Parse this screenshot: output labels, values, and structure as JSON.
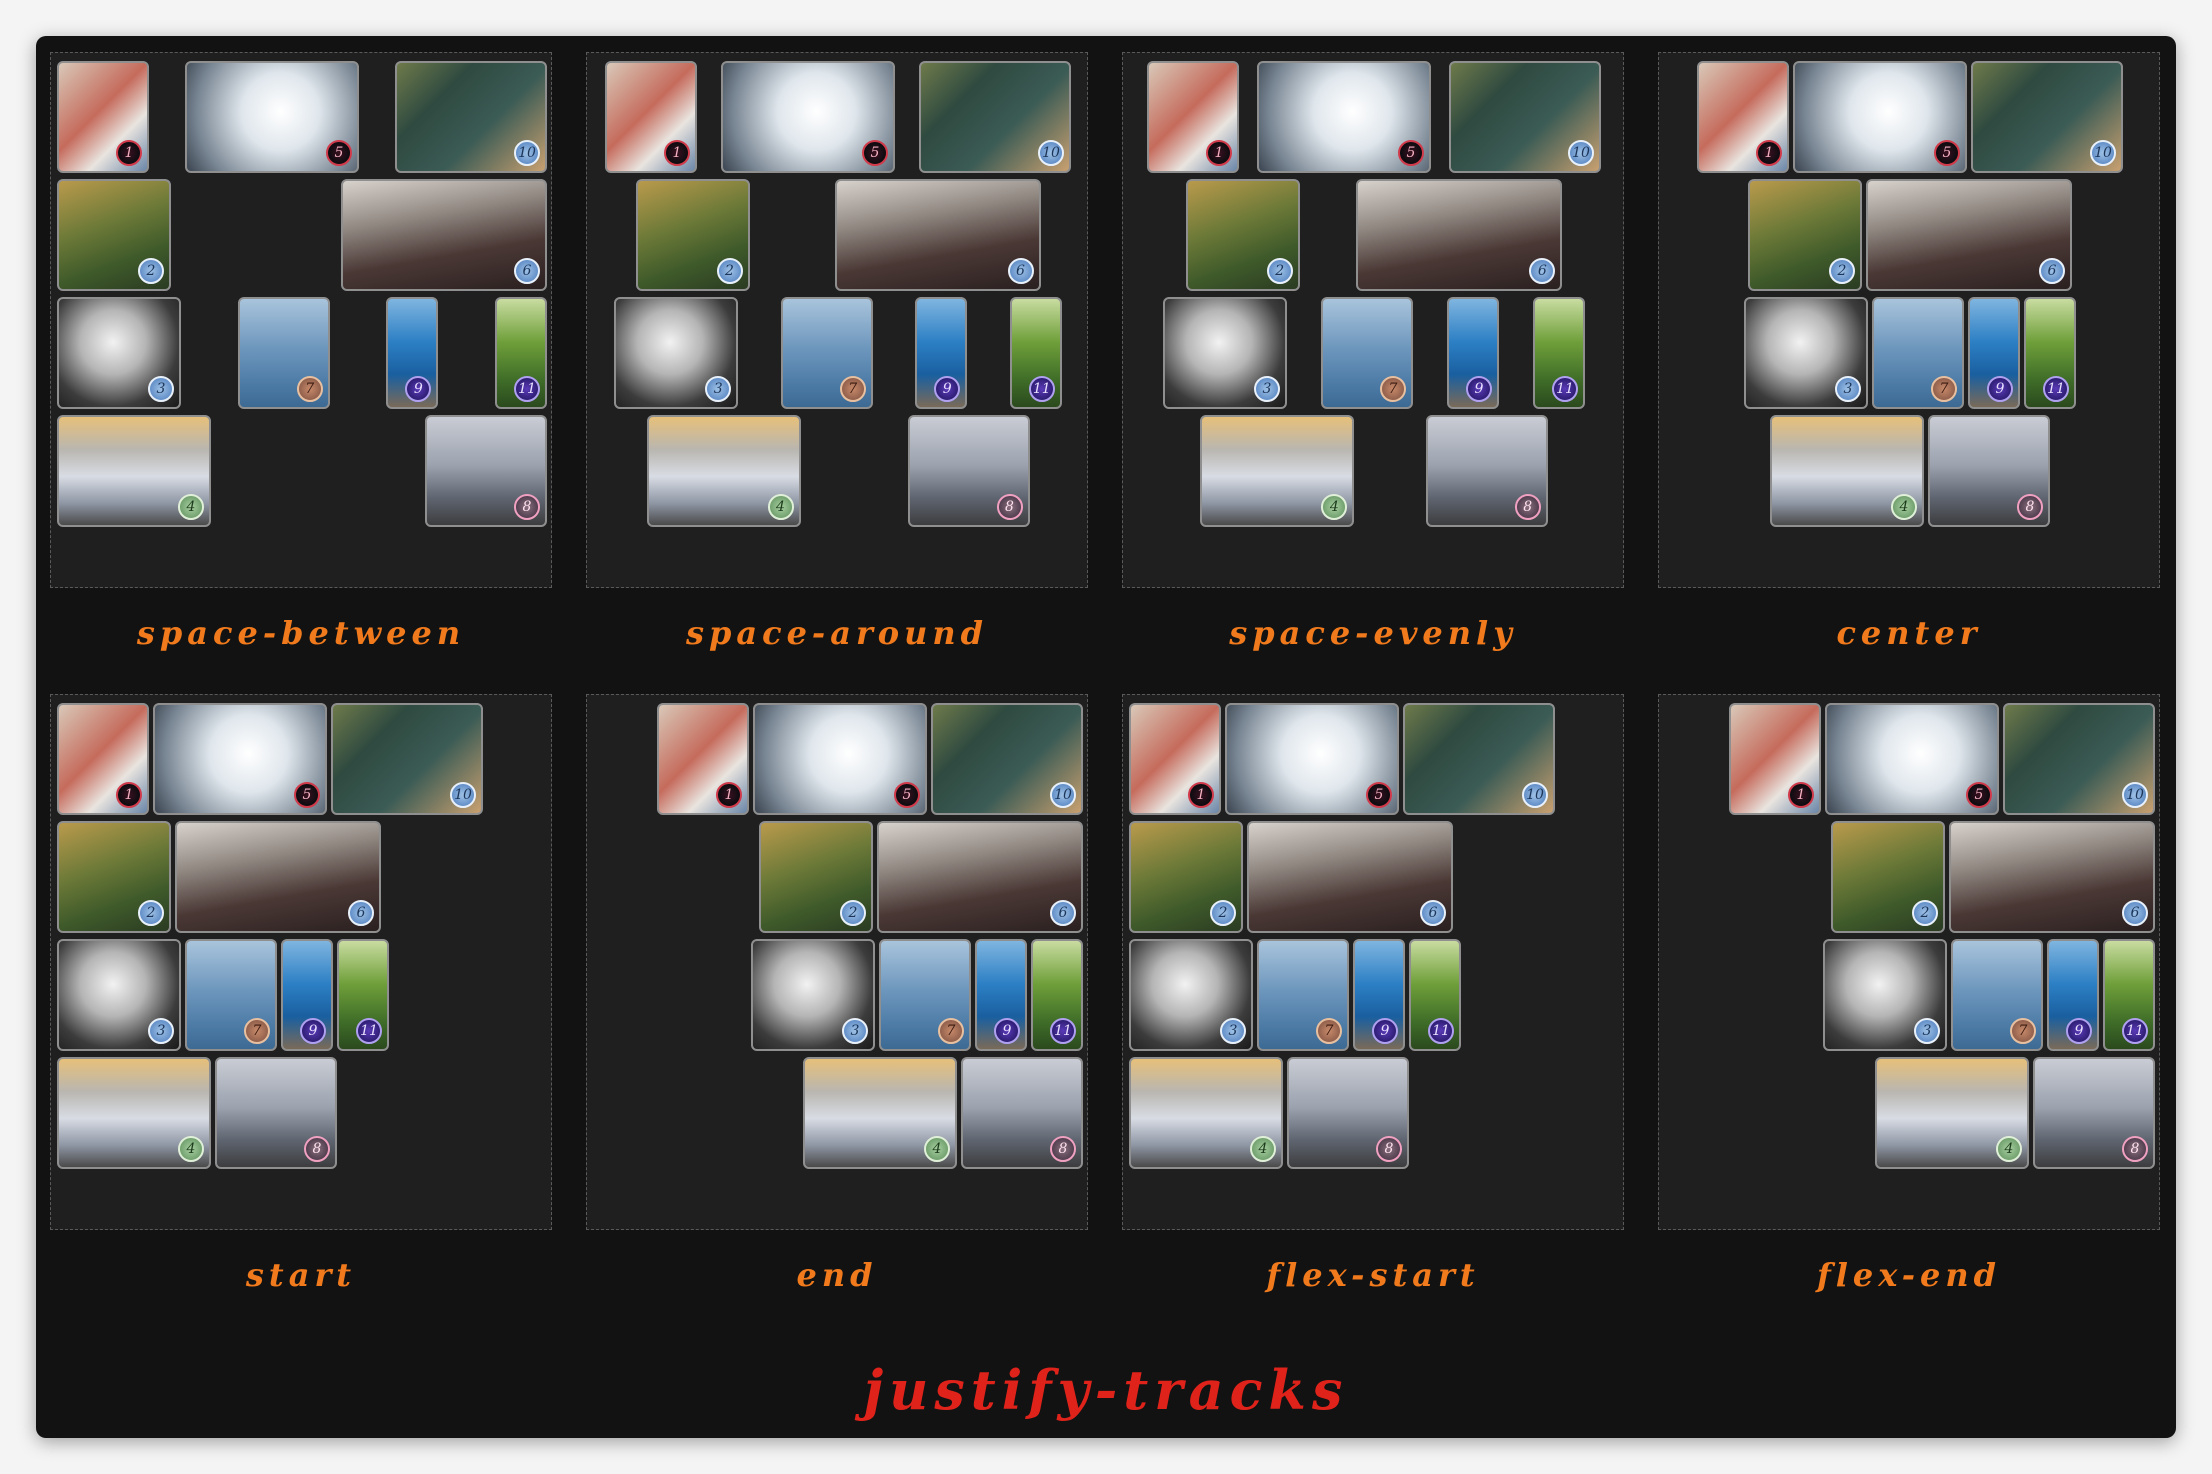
{
  "title": "justify-tracks",
  "colors": {
    "title": "#e0231a",
    "label": "#f07a1c",
    "stage": "#121212",
    "panel": "#1f1f1f"
  },
  "panels": [
    {
      "label": "space-between",
      "mode": "space-between"
    },
    {
      "label": "space-around",
      "mode": "space-around"
    },
    {
      "label": "space-evenly",
      "mode": "space-evenly"
    },
    {
      "label": "center",
      "mode": "center"
    },
    {
      "label": "start",
      "mode": "start"
    },
    {
      "label": "end",
      "mode": "end"
    },
    {
      "label": "flex-start",
      "mode": "flex-start"
    },
    {
      "label": "flex-end",
      "mode": "flex-end"
    }
  ],
  "rows": [
    [
      {
        "n": "1",
        "subject": "hand-writing-photo",
        "bg": "linear-gradient(135deg,#d9c8b8 0%,#c56b5c 45%,#e9e4df 70%,#6a86a8 100%)",
        "badge": "dark"
      },
      {
        "n": "5",
        "subject": "laptop-light-photo",
        "bg": "radial-gradient(circle at 55% 45%,#ffffff 0%,#dfe6ec 35%,#7a8794 75%,#3a4450 100%)",
        "badge": "dark"
      },
      {
        "n": "10",
        "subject": "ereader-photo",
        "bg": "linear-gradient(135deg,#6e7a4a 0%,#2f4a40 30%,#3b5b55 60%,#c8a070 100%)",
        "badge": "blue"
      }
    ],
    [
      {
        "n": "2",
        "subject": "canyon-photo",
        "bg": "linear-gradient(160deg,#b99a4c 0%,#6d7a38 40%,#3f5a2a 70%,#2a3b22 100%)",
        "badge": "blue"
      },
      {
        "n": "6",
        "subject": "car-dashboard-photo",
        "bg": "linear-gradient(170deg,#d8d2cc 0%,#8f8680 35%,#4a3835 65%,#2a2020 100%)",
        "badge": "blue"
      }
    ],
    [
      {
        "n": "3",
        "subject": "old-tv-photo",
        "bg": "radial-gradient(ellipse at 45% 40%,#f2f2f2 0%,#b5b5b5 35%,#3c3c3c 70%,#1a1a1a 100%)",
        "badge": "blue"
      },
      {
        "n": "7",
        "subject": "sea-of-clouds-photo",
        "bg": "linear-gradient(180deg,#a9c4dc 0%,#6e97bd 45%,#4b7aa5 80%,#3d6a93 100%)",
        "badge": "orange"
      },
      {
        "n": "9",
        "subject": "fjord-photo",
        "bg": "linear-gradient(180deg,#7fb5e0 0%,#2c7fc4 40%,#1a5fa0 70%,#7a6a58 100%)",
        "badge": "violet"
      },
      {
        "n": "11",
        "subject": "forest-tree-photo",
        "bg": "linear-gradient(180deg,#c8dca0 0%,#6f9f3a 40%,#3f6d28 75%,#2b4a1e 100%)",
        "badge": "violet"
      }
    ],
    [
      {
        "n": "4",
        "subject": "person-above-clouds-photo",
        "bg": "linear-gradient(180deg,#e6c07a 0%,#b9b6b0 30%,#d8dce4 55%,#8e96a4 80%,#4a4a4a 100%)",
        "badge": "green"
      },
      {
        "n": "8",
        "subject": "misty-cliff-photo",
        "bg": "linear-gradient(180deg,#c9ccd4 0%,#9ba2ae 45%,#5f6570 75%,#3d3d3f 100%)",
        "badge": "pink"
      }
    ]
  ]
}
